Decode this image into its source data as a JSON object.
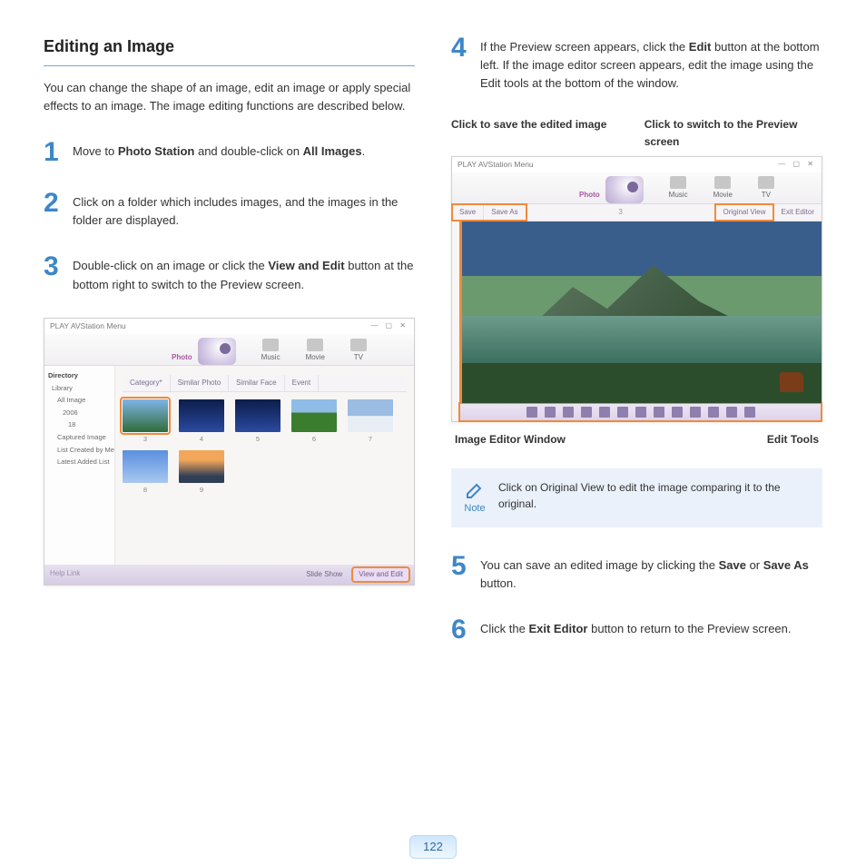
{
  "title": "Editing an Image",
  "intro": "You can change the shape of an image, edit an image or apply special effects to an image. The image editing functions are described below.",
  "steps": {
    "s1": {
      "num": "1",
      "pre": "Move to ",
      "b1": "Photo Station",
      "mid": " and double-click on ",
      "b2": "All Images",
      "post": "."
    },
    "s2": {
      "num": "2",
      "text": "Click on a folder which includes images, and the images in the folder are displayed."
    },
    "s3": {
      "num": "3",
      "pre": "Double-click on an image or click the ",
      "b1": "View and Edit",
      "post": " button at the bottom right to switch to the Preview screen."
    },
    "s4": {
      "num": "4",
      "pre": "If the Preview screen appears, click the ",
      "b1": "Edit",
      "post": " button at the bottom left. If the image editor screen appears, edit the image using the Edit tools at the bottom of the window."
    },
    "s5": {
      "num": "5",
      "pre": "You can save an edited image by clicking the ",
      "b1": "Save",
      "mid": " or ",
      "b2": "Save As",
      "post": " button."
    },
    "s6": {
      "num": "6",
      "pre": "Click the ",
      "b1": "Exit Editor",
      "post": " button to return to the Preview screen."
    }
  },
  "app": {
    "title": "PLAY AVStation",
    "menu": "Menu",
    "tabs": {
      "photo": "Photo",
      "music": "Music",
      "movie": "Movie",
      "tv": "TV"
    },
    "sidebar_header": "Directory",
    "sidebar": [
      "Library",
      "All Image",
      "2006",
      "18",
      "Captured Image",
      "List Created by Me",
      "Latest Added List"
    ],
    "toolbar": [
      "Category*",
      "Similar Photo",
      "Similar Face",
      "Event"
    ],
    "thumb_labels": [
      "3",
      "4",
      "5",
      "6",
      "7",
      "8",
      "9"
    ],
    "footer": {
      "help": "Help Link",
      "slideshow": "Slide Show",
      "viewedit": "View and Edit"
    }
  },
  "editor": {
    "callout_save": "Click to save the edited image",
    "callout_preview": "Click to switch to the Preview screen",
    "save": "Save",
    "saveas": "Save As",
    "orig": "Original View",
    "exit": "Exit Editor",
    "label_window": "Image Editor Window",
    "label_tools": "Edit Tools"
  },
  "note": {
    "label": "Note",
    "text": "Click on Original View to edit the image comparing it to the original."
  },
  "page": "122"
}
